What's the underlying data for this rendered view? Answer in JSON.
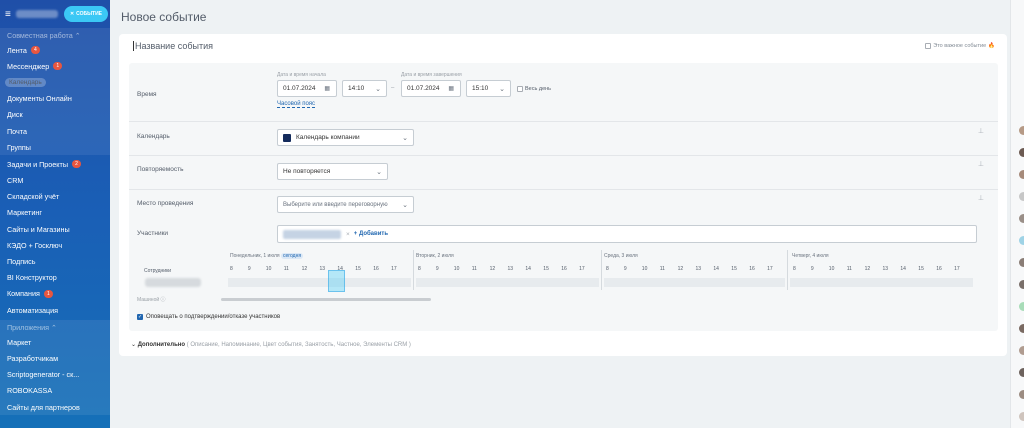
{
  "sidebar": {
    "event_button": "СОБЫТИЕ",
    "groups": [
      {
        "title": "Совместная работа ⌃",
        "items": [
          {
            "label": "Лента",
            "badge": "4"
          },
          {
            "label": "Мессенджер",
            "badge": "1"
          },
          {
            "label": "Календарь",
            "active": true
          },
          {
            "label": "Документы Онлайн"
          },
          {
            "label": "Диск"
          },
          {
            "label": "Почта"
          },
          {
            "label": "Группы"
          }
        ]
      }
    ],
    "items": [
      {
        "label": "Задачи и Проекты",
        "badge": "2"
      },
      {
        "label": "CRM"
      },
      {
        "label": "Складской учёт"
      },
      {
        "label": "Маркетинг"
      },
      {
        "label": "Сайты и Магазины"
      },
      {
        "label": "КЭДО + Госключ"
      },
      {
        "label": "Подпись"
      },
      {
        "label": "BI Конструктор"
      },
      {
        "label": "Компания",
        "badge": "1"
      },
      {
        "label": "Автоматизация"
      }
    ],
    "apps_group": {
      "title": "Приложения ⌃",
      "items": [
        {
          "label": "Маркет"
        },
        {
          "label": "Разработчикам"
        },
        {
          "label": "Scriptogenerator - ск..."
        },
        {
          "label": "ROBOKASSA"
        },
        {
          "label": "Сайты для партнеров"
        }
      ]
    }
  },
  "page": {
    "title": "Новое событие",
    "event_name_placeholder": "Название события",
    "important_label": "Это важное событие"
  },
  "form": {
    "time": {
      "label": "Время",
      "start_caption": "Дата и время начала",
      "end_caption": "Дата и время завершения",
      "start_date": "01.07.2024",
      "start_time": "14:10",
      "dash": "–",
      "end_date": "01.07.2024",
      "end_time": "15:10",
      "all_day": "Весь день",
      "timezone_link": "Часовой пояс"
    },
    "calendar": {
      "label": "Календарь",
      "value": "Календарь компании"
    },
    "repeat": {
      "label": "Повторяемость",
      "value": "Не повторяется"
    },
    "location": {
      "label": "Место проведения",
      "placeholder": "Выберите или введите переговорную"
    },
    "participants": {
      "label": "Участники",
      "add": "+ Добавить"
    },
    "planner": {
      "days": [
        {
          "label": "Понедельник, 1 июля",
          "today": "сегодня"
        },
        {
          "label": "Вторник, 2 июля"
        },
        {
          "label": "Среда, 3 июля"
        },
        {
          "label": "Четверг, 4 июля"
        }
      ],
      "hours": [
        "8",
        "9",
        "10",
        "11",
        "12",
        "13",
        "14",
        "15",
        "16",
        "17"
      ],
      "employees_label": "Сотрудники",
      "rooms_label": "Машиной ⓘ"
    },
    "notify_label": "Оповещать о подтверждении/отказе участников"
  },
  "more": {
    "label": "Дополнительно",
    "sub": "( Описание,  Напоминание,  Цвет события,  Занятость,  Частное,  Элементы CRM )"
  },
  "colors": {
    "sidebar": "#1f4fa8",
    "accent": "#3bc8f5",
    "link": "#2067b0"
  }
}
